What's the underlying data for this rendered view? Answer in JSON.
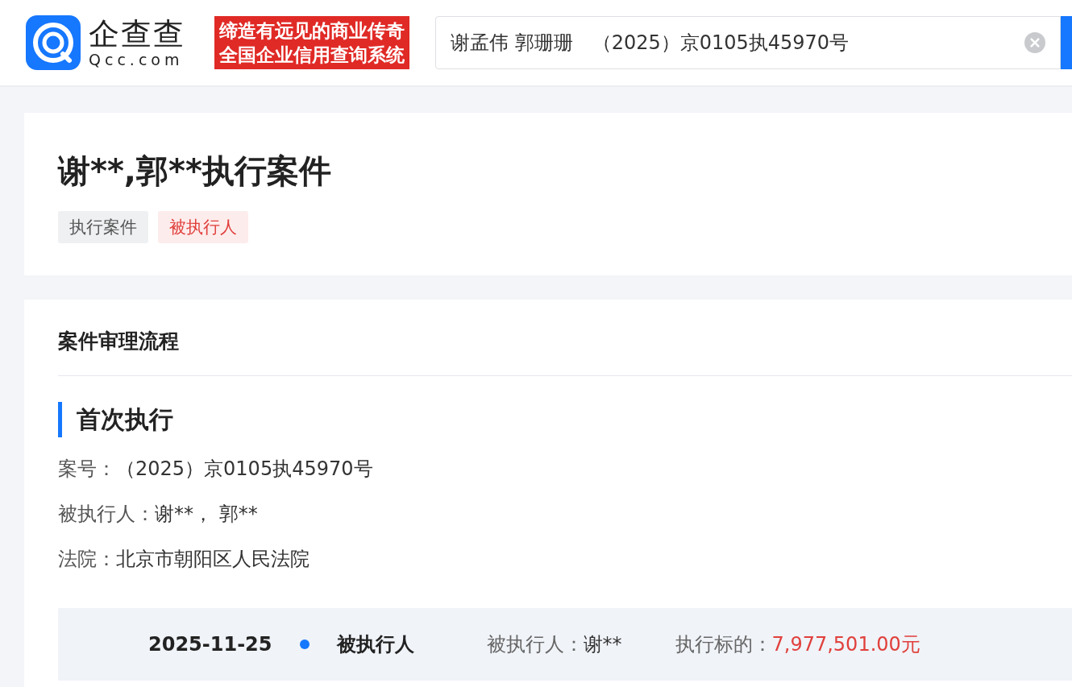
{
  "header": {
    "logo_name": "企查查",
    "logo_domain": "Qcc.com",
    "slogan": [
      "缔造有远见的商业传奇",
      "全国企业信用查询系统"
    ],
    "search": {
      "value": "谢孟伟 郭珊珊　（2025）京0105执45970号"
    }
  },
  "case": {
    "title": "谢**,郭**执行案件",
    "tags": [
      {
        "label": "执行案件",
        "kind": "neutral"
      },
      {
        "label": "被执行人",
        "kind": "alert"
      }
    ]
  },
  "process": {
    "heading": "案件审理流程",
    "stage": "首次执行",
    "fields": [
      {
        "label": "案号：",
        "value": "（2025）京0105执45970号"
      },
      {
        "label": "被执行人：",
        "value": "谢**，  郭**"
      },
      {
        "label": "法院：",
        "value": "北京市朝阳区人民法院"
      }
    ],
    "timeline": [
      {
        "date": "2025-11-25",
        "event": "被执行人",
        "party_label": "被执行人：",
        "party": "谢**",
        "amount_label": "执行标的：",
        "amount": "7,977,501.00元"
      }
    ]
  }
}
